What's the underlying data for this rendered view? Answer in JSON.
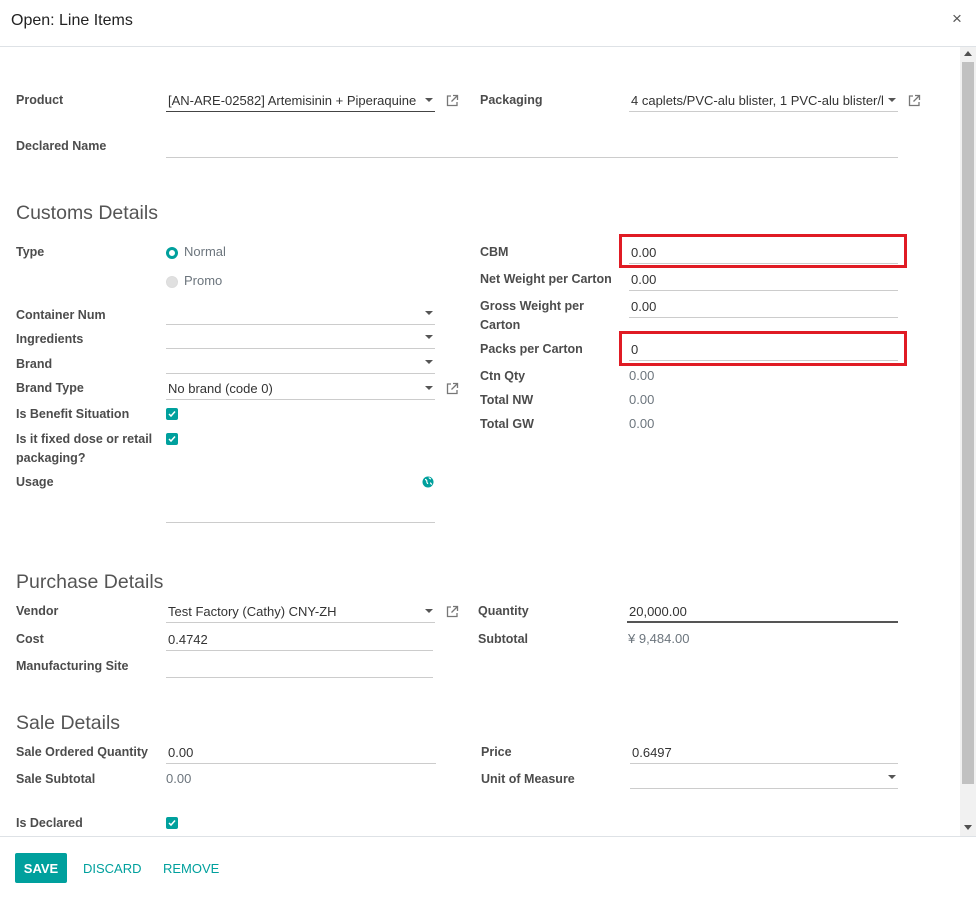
{
  "dialog": {
    "title": "Open: Line Items",
    "close_glyph": "×"
  },
  "product": {
    "label": "Product",
    "value": "[AN-ARE-02582] Artemisinin + Piperaquine ("
  },
  "packaging": {
    "label": "Packaging",
    "value": "4 caplets/PVC-alu blister, 1 PVC-alu blister/l"
  },
  "declared_name": {
    "label": "Declared Name",
    "value": ""
  },
  "customs": {
    "heading": "Customs Details",
    "type_label": "Type",
    "type_options": [
      "Normal",
      "Promo"
    ],
    "container_num_label": "Container Num",
    "ingredients_label": "Ingredients",
    "brand_label": "Brand",
    "brand_type_label": "Brand Type",
    "brand_type_value": "No brand (code 0)",
    "benefit_label": "Is Benefit Situation",
    "fixed_dose_label_1": "Is it fixed dose or retail",
    "fixed_dose_label_2": "packaging?",
    "usage_label": "Usage",
    "cbm_label": "CBM",
    "cbm_value": "0.00",
    "net_weight_label": "Net Weight per Carton",
    "net_weight_value": "0.00",
    "gross_weight_label_1": "Gross Weight per",
    "gross_weight_label_2": "Carton",
    "gross_weight_value": "0.00",
    "packs_label": "Packs per Carton",
    "packs_value": "0",
    "ctn_qty_label": "Ctn Qty",
    "ctn_qty_value": "0.00",
    "total_nw_label": "Total NW",
    "total_nw_value": "0.00",
    "total_gw_label": "Total GW",
    "total_gw_value": "0.00"
  },
  "purchase": {
    "heading": "Purchase Details",
    "vendor_label": "Vendor",
    "vendor_value": "Test Factory (Cathy) CNY-ZH",
    "cost_label": "Cost",
    "cost_value": "0.4742",
    "mfg_site_label": "Manufacturing Site",
    "quantity_label": "Quantity",
    "quantity_value": "20,000.00",
    "subtotal_label": "Subtotal",
    "subtotal_value": "¥ 9,484.00"
  },
  "sale": {
    "heading": "Sale Details",
    "ordered_qty_label": "Sale Ordered Quantity",
    "ordered_qty_value": "0.00",
    "subtotal_label": "Sale Subtotal",
    "subtotal_value": "0.00",
    "price_label": "Price",
    "price_value": "0.6497",
    "uom_label": "Unit of Measure",
    "is_declared_label": "Is Declared"
  },
  "footer": {
    "save": "SAVE",
    "discard": "DISCARD",
    "remove": "REMOVE"
  },
  "colors": {
    "accent": "#00a09d",
    "highlight": "#e01b24"
  }
}
